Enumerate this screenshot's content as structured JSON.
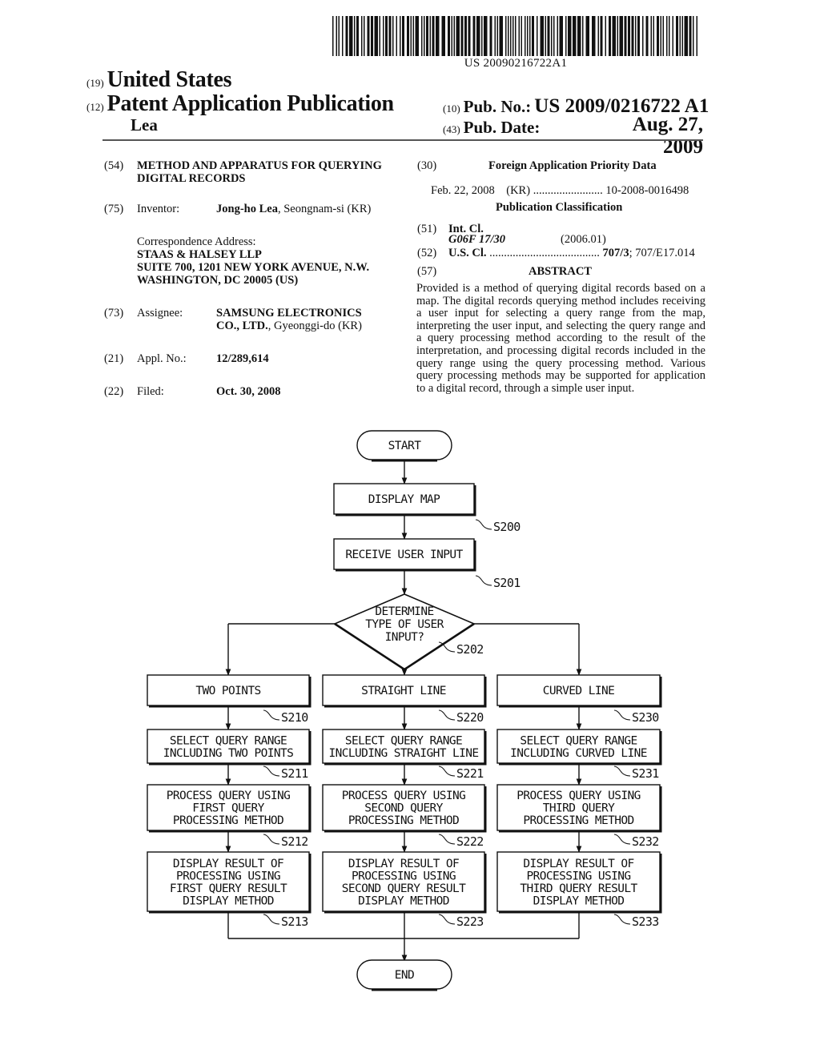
{
  "header": {
    "barcode_number": "US 20090216722A1",
    "country_code": "(19)",
    "country": "United States",
    "type_code": "(12)",
    "type": "Patent Application Publication",
    "inventor_surname": "Lea",
    "pub_no_code": "(10)",
    "pub_no_label": "Pub. No.:",
    "pub_no_value": "US 2009/0216722 A1",
    "pub_date_code": "(43)",
    "pub_date_label": "Pub. Date:",
    "pub_date_value": "Aug. 27, 2009"
  },
  "biblio": {
    "title_code": "(54)",
    "title_line1": "METHOD AND APPARATUS FOR QUERYING",
    "title_line2": "DIGITAL RECORDS",
    "inventor_code": "(75)",
    "inventor_label": "Inventor:",
    "inventor_name": "Jong-ho Lea",
    "inventor_location": ", Seongnam-si (KR)",
    "correspondence_label": "Correspondence Address:",
    "correspondence_lines": [
      "STAAS & HALSEY LLP",
      "SUITE 700, 1201 NEW YORK AVENUE, N.W.",
      "WASHINGTON, DC 20005 (US)"
    ],
    "assignee_code": "(73)",
    "assignee_label": "Assignee:",
    "assignee_line1": "SAMSUNG ELECTRONICS",
    "assignee_line2_bold": "CO., LTD.",
    "assignee_line2_rest": ", Gyeonggi-do (KR)",
    "appl_code": "(21)",
    "appl_label": "Appl. No.:",
    "appl_value": "12/289,614",
    "filed_code": "(22)",
    "filed_label": "Filed:",
    "filed_value": "Oct. 30, 2008"
  },
  "right_column": {
    "foreign_code": "(30)",
    "foreign_title": "Foreign Application Priority Data",
    "foreign_date": "Feb. 22, 2008",
    "foreign_country": "(KR)",
    "foreign_dots": "........................",
    "foreign_number": "10-2008-0016498",
    "pubclass_title": "Publication Classification",
    "intcl_code": "(51)",
    "intcl_label": "Int. Cl.",
    "intcl_class": "G06F 17/30",
    "intcl_version": "(2006.01)",
    "uscl_code": "(52)",
    "uscl_label": "U.S. Cl.",
    "uscl_dots": "......................................",
    "uscl_primary": "707/3",
    "uscl_secondary": "; 707/E17.014",
    "abstract_code": "(57)",
    "abstract_title": "ABSTRACT",
    "abstract_text": "Provided is a method of querying digital records based on a map. The digital records querying method includes receiving a user input for selecting a query range from the map, interpreting the user input, and selecting the query range and a query processing method according to the result of the interpretation, and processing digital records included in the query range using the query processing method. Various query processing methods may be supported for application to a digital record, through a simple user input."
  },
  "flowchart": {
    "start": "START",
    "end": "END",
    "s200": {
      "lines": [
        "DISPLAY MAP"
      ],
      "label": "S200"
    },
    "s201": {
      "lines": [
        "RECEIVE USER INPUT"
      ],
      "label": "S201"
    },
    "s202": {
      "lines": [
        "DETERMINE",
        "TYPE OF USER",
        "INPUT?"
      ],
      "label": "S202"
    },
    "branches": [
      {
        "type": {
          "lines": [
            "TWO POINTS"
          ],
          "label": "S210"
        },
        "select": {
          "lines": [
            "SELECT QUERY RANGE",
            "INCLUDING TWO POINTS"
          ],
          "label": "S211"
        },
        "process": {
          "lines": [
            "PROCESS QUERY USING",
            "FIRST QUERY",
            "PROCESSING METHOD"
          ],
          "label": "S212"
        },
        "display": {
          "lines": [
            "DISPLAY RESULT OF",
            "PROCESSING USING",
            "FIRST QUERY RESULT",
            "DISPLAY METHOD"
          ],
          "label": "S213"
        }
      },
      {
        "type": {
          "lines": [
            "STRAIGHT LINE"
          ],
          "label": "S220"
        },
        "select": {
          "lines": [
            "SELECT QUERY RANGE",
            "INCLUDING STRAIGHT LINE"
          ],
          "label": "S221"
        },
        "process": {
          "lines": [
            "PROCESS QUERY USING",
            "SECOND QUERY",
            "PROCESSING METHOD"
          ],
          "label": "S222"
        },
        "display": {
          "lines": [
            "DISPLAY RESULT OF",
            "PROCESSING USING",
            "SECOND QUERY RESULT",
            "DISPLAY METHOD"
          ],
          "label": "S223"
        }
      },
      {
        "type": {
          "lines": [
            "CURVED LINE"
          ],
          "label": "S230"
        },
        "select": {
          "lines": [
            "SELECT QUERY RANGE",
            "INCLUDING CURVED LINE"
          ],
          "label": "S231"
        },
        "process": {
          "lines": [
            "PROCESS QUERY USING",
            "THIRD QUERY",
            "PROCESSING METHOD"
          ],
          "label": "S232"
        },
        "display": {
          "lines": [
            "DISPLAY RESULT OF",
            "PROCESSING USING",
            "THIRD QUERY RESULT",
            "DISPLAY METHOD"
          ],
          "label": "S233"
        }
      }
    ]
  }
}
